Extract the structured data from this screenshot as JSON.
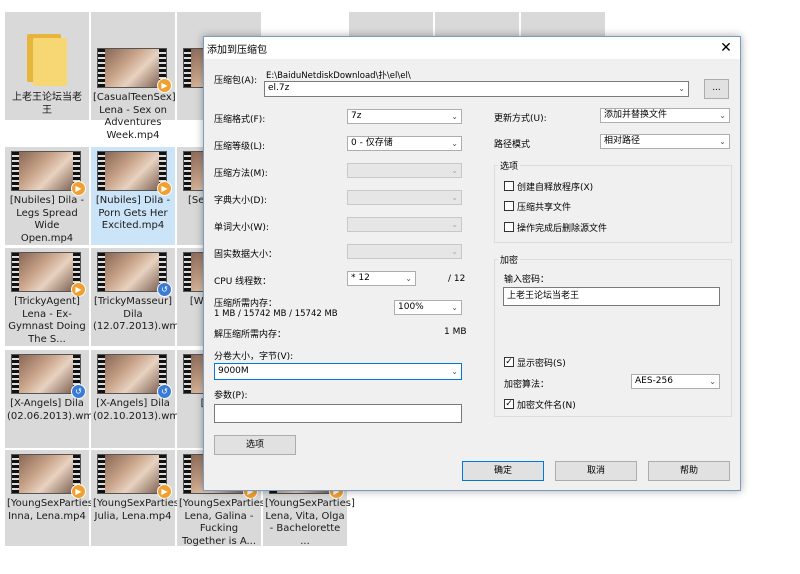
{
  "explorer": {
    "items": [
      {
        "caption": "上老王论坛当老\n王",
        "kind": "folder"
      },
      {
        "caption": "[CasualTeenSex] Lena - Sex on Adventures Week.mp4",
        "kind": "video"
      },
      {
        "caption": "[Di",
        "kind": "video"
      },
      {
        "caption": "[Nubiles] Dila - Legs Spread Wide Open.mp4",
        "kind": "video"
      },
      {
        "caption": "[Nubiles] Dila - Porn Gets Her Excited.mp4",
        "kind": "video"
      },
      {
        "caption": "[Se Le Idi an",
        "kind": "video"
      },
      {
        "caption": "[TrickyAgent] Lena - Ex-Gymnast Doing The S...",
        "kind": "video"
      },
      {
        "caption": "[TrickyMasseur] Dila (12.07.2013).wmv",
        "kind": "video"
      },
      {
        "caption": "[W Ang Exp",
        "kind": "video"
      },
      {
        "caption": "[X-Angels] Dila (02.06.2013).wmv",
        "kind": "video"
      },
      {
        "caption": "[X-Angels] Dila (02.10.2013).wmv",
        "kind": "video"
      },
      {
        "caption": "[X- (25.",
        "kind": "video"
      },
      {
        "caption": "[YoungSexParties] Inna, Lena.mp4",
        "kind": "video"
      },
      {
        "caption": "[YoungSexParties] Julia, Lena.mp4",
        "kind": "video"
      },
      {
        "caption": "[YoungSexParties] Lena, Galina - Fucking Together is A...",
        "kind": "video"
      },
      {
        "caption": "[YoungSexParties] Lena, Vita, Olga - Bachelorette ...",
        "kind": "video"
      }
    ]
  },
  "dialog": {
    "title": "添加到压缩包",
    "close": "✕",
    "archive_label": "压缩包(A):",
    "archive_dir": "E:\\BaiduNetdiskDownload\\扑\\el\\el\\",
    "archive_name": "el.7z",
    "browse": "...",
    "format_label": "压缩格式(F):",
    "format_value": "7z",
    "level_label": "压缩等级(L):",
    "level_value": "0 - 仅存储",
    "method_label": "压缩方法(M):",
    "dict_label": "字典大小(D):",
    "word_label": "单词大小(W):",
    "solid_label": "固实数据大小：",
    "cpu_label": "CPU 线程数：",
    "cpu_value": "* 12",
    "cpu_total": "/ 12",
    "mem_comp_label": "压缩所需内存：",
    "mem_comp_detail": "1 MB / 15742 MB / 15742 MB",
    "mem_percent": "100%",
    "mem_decomp_label": "解压缩所需内存：",
    "mem_decomp_value": "1 MB",
    "split_label": "分卷大小，字节(V):",
    "split_value": "9000M",
    "params_label": "参数(P):",
    "params_value": "",
    "options_button": "选项",
    "update_label": "更新方式(U):",
    "update_value": "添加并替换文件",
    "path_label": "路径模式",
    "path_value": "相对路径",
    "options_group": "选项",
    "opt_sfx": "创建自释放程序(X)",
    "opt_shared": "压缩共享文件",
    "opt_delete": "操作完成后删除源文件",
    "enc_group": "加密",
    "pwd_label": "输入密码：",
    "pwd_value": "上老王论坛当老王",
    "show_pwd": "显示密码(S)",
    "enc_method_label": "加密算法：",
    "enc_method_value": "AES-256",
    "enc_names": "加密文件名(N)",
    "ok": "确定",
    "cancel": "取消",
    "help": "帮助",
    "checked": "✓",
    "arrow": "⌄"
  }
}
